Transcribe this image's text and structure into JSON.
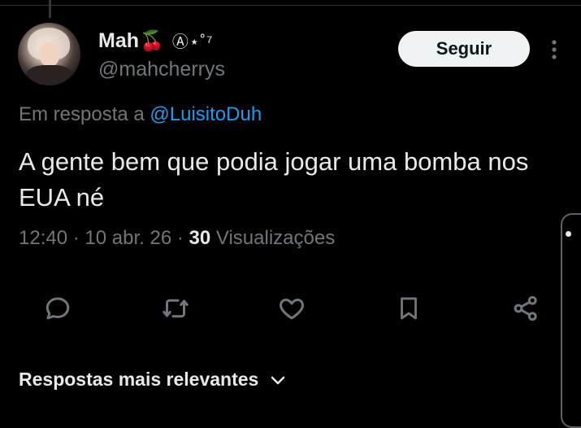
{
  "author": {
    "display_name": "Mah",
    "name_emoji": "🍒",
    "name_decoration": "Ⓐ⋆˚⁷",
    "handle": "@mahcherrys"
  },
  "follow_button": {
    "label": "Seguir"
  },
  "reply_context": {
    "prefix": "Em resposta a",
    "mention": "@LuisitoDuh"
  },
  "tweet": {
    "text": "A gente bem que podia jogar uma bomba nos EUA né",
    "time": "12:40",
    "separator": "·",
    "date": "10 abr. 26",
    "views_count": "30",
    "views_label": "Visualizações"
  },
  "actions": {
    "icons": [
      "reply-icon",
      "retweet-icon",
      "like-icon",
      "bookmark-icon",
      "share-icon"
    ]
  },
  "replies_sort": {
    "label": "Respostas mais relevantes"
  },
  "colors": {
    "background": "#000000",
    "text": "#e7e9ea",
    "muted": "#71767b",
    "link": "#1d9bf0"
  }
}
